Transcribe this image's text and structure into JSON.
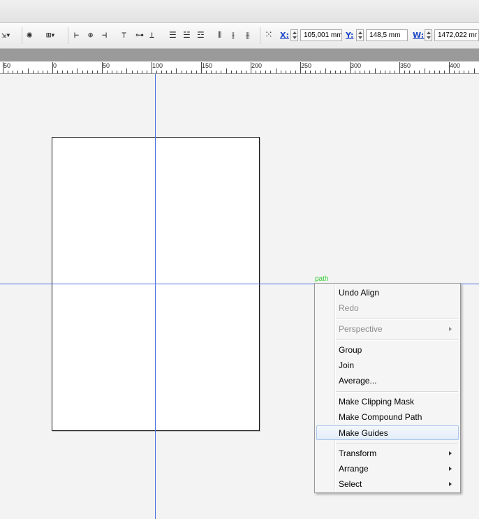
{
  "toolbar": {
    "icons": [
      {
        "name": "selection-tool-options-icon",
        "glyph": "⇲▾"
      },
      {
        "name": "recolor-artwork-icon",
        "glyph": "✺"
      },
      {
        "name": "isolate-object-icon",
        "glyph": "⊞▾"
      },
      {
        "name": "align-left-icon",
        "glyph": "⊢"
      },
      {
        "name": "align-horizontal-center-icon",
        "glyph": "⊕"
      },
      {
        "name": "align-right-icon",
        "glyph": "⊣"
      },
      {
        "name": "align-top-icon",
        "glyph": "⊤"
      },
      {
        "name": "align-vertical-center-icon",
        "glyph": "⊶"
      },
      {
        "name": "align-bottom-icon",
        "glyph": "⊥"
      },
      {
        "name": "distribute-top-icon",
        "glyph": "☰"
      },
      {
        "name": "distribute-vertical-center-icon",
        "glyph": "☱"
      },
      {
        "name": "distribute-bottom-icon",
        "glyph": "☲"
      },
      {
        "name": "distribute-left-icon",
        "glyph": "⫴"
      },
      {
        "name": "distribute-horizontal-center-icon",
        "glyph": "⫲"
      },
      {
        "name": "distribute-right-icon",
        "glyph": "⫵"
      },
      {
        "name": "reference-point-icon",
        "glyph": "⁙"
      }
    ],
    "x_label": "X:",
    "x_value": "105,001 mm",
    "y_label": "Y:",
    "y_value": "148,5 mm",
    "w_label": "W:",
    "w_value": "1472,022 mr"
  },
  "ruler": {
    "labels": [
      "50",
      "0",
      "50",
      "100",
      "150",
      "200",
      "250",
      "300",
      "350",
      "400"
    ]
  },
  "canvas": {
    "selection_label": "path",
    "guide_color": "#4a6fe0"
  },
  "context_menu": {
    "items": [
      {
        "label": "Undo Align",
        "state": "enabled",
        "submenu": false
      },
      {
        "label": "Redo",
        "state": "disabled",
        "submenu": false
      },
      {
        "label": "Perspective",
        "state": "disabled",
        "submenu": true
      },
      {
        "label": "Group",
        "state": "enabled",
        "submenu": false
      },
      {
        "label": "Join",
        "state": "enabled",
        "submenu": false
      },
      {
        "label": "Average...",
        "state": "enabled",
        "submenu": false
      },
      {
        "label": "Make Clipping Mask",
        "state": "enabled",
        "submenu": false
      },
      {
        "label": "Make Compound Path",
        "state": "enabled",
        "submenu": false
      },
      {
        "label": "Make Guides",
        "state": "highlighted",
        "submenu": false
      },
      {
        "label": "Transform",
        "state": "enabled",
        "submenu": true
      },
      {
        "label": "Arrange",
        "state": "enabled",
        "submenu": true
      },
      {
        "label": "Select",
        "state": "enabled",
        "submenu": true
      }
    ]
  }
}
